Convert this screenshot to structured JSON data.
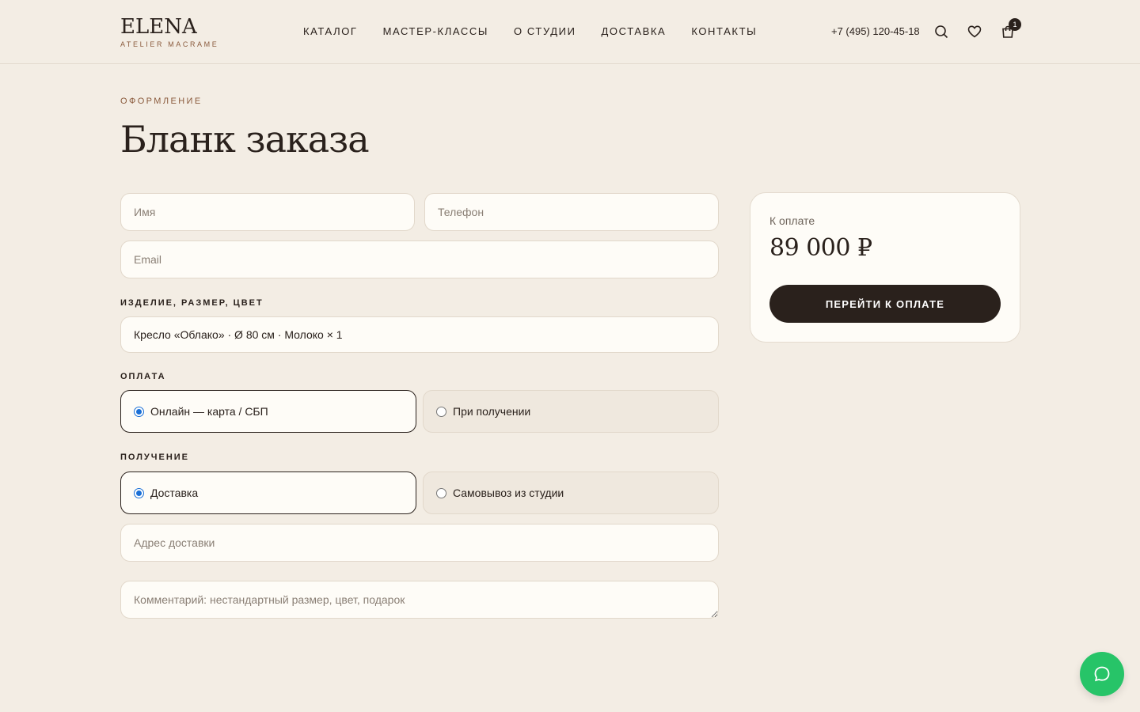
{
  "header": {
    "logo_main": "ELENA",
    "logo_sub": "ATELIER MACRAME",
    "nav": [
      "КАТАЛОГ",
      "МАСТЕР-КЛАССЫ",
      "О СТУДИИ",
      "ДОСТАВКА",
      "КОНТАКТЫ"
    ],
    "phone": "+7 (495) 120-45-18",
    "cart_count": "1",
    "icons": [
      "search-icon",
      "heart-icon",
      "cart-icon"
    ]
  },
  "page": {
    "eyebrow": "ОФОРМЛЕНИЕ",
    "title": "Бланк заказа"
  },
  "form": {
    "name_placeholder": "Имя",
    "phone_placeholder": "Телефон",
    "email_placeholder": "Email",
    "product_label": "ИЗДЕЛИЕ, РАЗМЕР, ЦВЕТ",
    "product_value": "Кресло «Облако» · Ø 80 см · Молоко × 1",
    "payment_label": "ОПЛАТА",
    "payment_options": [
      "Онлайн — карта / СБП",
      "При получении"
    ],
    "payment_selected": "Онлайн — карта / СБП",
    "delivery_label": "ПОЛУЧЕНИЕ",
    "delivery_options": [
      "Доставка",
      "Самовывоз из студии"
    ],
    "delivery_selected": "Доставка",
    "address_placeholder": "Адрес доставки",
    "comment_placeholder": "Комментарий: нестандартный размер, цвет, подарок"
  },
  "summary": {
    "label": "К оплате",
    "amount": "89 000 ₽",
    "pay_button": "ПЕРЕЙТИ К ОПЛАТЕ"
  },
  "colors": {
    "background": "#f3ede4",
    "accent_dark": "#2a211c",
    "accent_brown": "#8a5a3c",
    "chat_green": "#27c468"
  }
}
